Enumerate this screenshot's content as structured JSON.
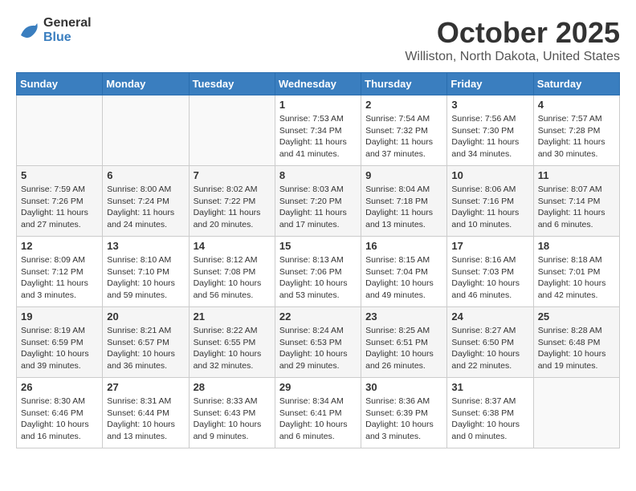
{
  "logo": {
    "line1": "General",
    "line2": "Blue"
  },
  "title": "October 2025",
  "location": "Williston, North Dakota, United States",
  "weekdays": [
    "Sunday",
    "Monday",
    "Tuesday",
    "Wednesday",
    "Thursday",
    "Friday",
    "Saturday"
  ],
  "weeks": [
    [
      {
        "day": "",
        "sunrise": "",
        "sunset": "",
        "daylight": ""
      },
      {
        "day": "",
        "sunrise": "",
        "sunset": "",
        "daylight": ""
      },
      {
        "day": "",
        "sunrise": "",
        "sunset": "",
        "daylight": ""
      },
      {
        "day": "1",
        "sunrise": "Sunrise: 7:53 AM",
        "sunset": "Sunset: 7:34 PM",
        "daylight": "Daylight: 11 hours and 41 minutes."
      },
      {
        "day": "2",
        "sunrise": "Sunrise: 7:54 AM",
        "sunset": "Sunset: 7:32 PM",
        "daylight": "Daylight: 11 hours and 37 minutes."
      },
      {
        "day": "3",
        "sunrise": "Sunrise: 7:56 AM",
        "sunset": "Sunset: 7:30 PM",
        "daylight": "Daylight: 11 hours and 34 minutes."
      },
      {
        "day": "4",
        "sunrise": "Sunrise: 7:57 AM",
        "sunset": "Sunset: 7:28 PM",
        "daylight": "Daylight: 11 hours and 30 minutes."
      }
    ],
    [
      {
        "day": "5",
        "sunrise": "Sunrise: 7:59 AM",
        "sunset": "Sunset: 7:26 PM",
        "daylight": "Daylight: 11 hours and 27 minutes."
      },
      {
        "day": "6",
        "sunrise": "Sunrise: 8:00 AM",
        "sunset": "Sunset: 7:24 PM",
        "daylight": "Daylight: 11 hours and 24 minutes."
      },
      {
        "day": "7",
        "sunrise": "Sunrise: 8:02 AM",
        "sunset": "Sunset: 7:22 PM",
        "daylight": "Daylight: 11 hours and 20 minutes."
      },
      {
        "day": "8",
        "sunrise": "Sunrise: 8:03 AM",
        "sunset": "Sunset: 7:20 PM",
        "daylight": "Daylight: 11 hours and 17 minutes."
      },
      {
        "day": "9",
        "sunrise": "Sunrise: 8:04 AM",
        "sunset": "Sunset: 7:18 PM",
        "daylight": "Daylight: 11 hours and 13 minutes."
      },
      {
        "day": "10",
        "sunrise": "Sunrise: 8:06 AM",
        "sunset": "Sunset: 7:16 PM",
        "daylight": "Daylight: 11 hours and 10 minutes."
      },
      {
        "day": "11",
        "sunrise": "Sunrise: 8:07 AM",
        "sunset": "Sunset: 7:14 PM",
        "daylight": "Daylight: 11 hours and 6 minutes."
      }
    ],
    [
      {
        "day": "12",
        "sunrise": "Sunrise: 8:09 AM",
        "sunset": "Sunset: 7:12 PM",
        "daylight": "Daylight: 11 hours and 3 minutes."
      },
      {
        "day": "13",
        "sunrise": "Sunrise: 8:10 AM",
        "sunset": "Sunset: 7:10 PM",
        "daylight": "Daylight: 10 hours and 59 minutes."
      },
      {
        "day": "14",
        "sunrise": "Sunrise: 8:12 AM",
        "sunset": "Sunset: 7:08 PM",
        "daylight": "Daylight: 10 hours and 56 minutes."
      },
      {
        "day": "15",
        "sunrise": "Sunrise: 8:13 AM",
        "sunset": "Sunset: 7:06 PM",
        "daylight": "Daylight: 10 hours and 53 minutes."
      },
      {
        "day": "16",
        "sunrise": "Sunrise: 8:15 AM",
        "sunset": "Sunset: 7:04 PM",
        "daylight": "Daylight: 10 hours and 49 minutes."
      },
      {
        "day": "17",
        "sunrise": "Sunrise: 8:16 AM",
        "sunset": "Sunset: 7:03 PM",
        "daylight": "Daylight: 10 hours and 46 minutes."
      },
      {
        "day": "18",
        "sunrise": "Sunrise: 8:18 AM",
        "sunset": "Sunset: 7:01 PM",
        "daylight": "Daylight: 10 hours and 42 minutes."
      }
    ],
    [
      {
        "day": "19",
        "sunrise": "Sunrise: 8:19 AM",
        "sunset": "Sunset: 6:59 PM",
        "daylight": "Daylight: 10 hours and 39 minutes."
      },
      {
        "day": "20",
        "sunrise": "Sunrise: 8:21 AM",
        "sunset": "Sunset: 6:57 PM",
        "daylight": "Daylight: 10 hours and 36 minutes."
      },
      {
        "day": "21",
        "sunrise": "Sunrise: 8:22 AM",
        "sunset": "Sunset: 6:55 PM",
        "daylight": "Daylight: 10 hours and 32 minutes."
      },
      {
        "day": "22",
        "sunrise": "Sunrise: 8:24 AM",
        "sunset": "Sunset: 6:53 PM",
        "daylight": "Daylight: 10 hours and 29 minutes."
      },
      {
        "day": "23",
        "sunrise": "Sunrise: 8:25 AM",
        "sunset": "Sunset: 6:51 PM",
        "daylight": "Daylight: 10 hours and 26 minutes."
      },
      {
        "day": "24",
        "sunrise": "Sunrise: 8:27 AM",
        "sunset": "Sunset: 6:50 PM",
        "daylight": "Daylight: 10 hours and 22 minutes."
      },
      {
        "day": "25",
        "sunrise": "Sunrise: 8:28 AM",
        "sunset": "Sunset: 6:48 PM",
        "daylight": "Daylight: 10 hours and 19 minutes."
      }
    ],
    [
      {
        "day": "26",
        "sunrise": "Sunrise: 8:30 AM",
        "sunset": "Sunset: 6:46 PM",
        "daylight": "Daylight: 10 hours and 16 minutes."
      },
      {
        "day": "27",
        "sunrise": "Sunrise: 8:31 AM",
        "sunset": "Sunset: 6:44 PM",
        "daylight": "Daylight: 10 hours and 13 minutes."
      },
      {
        "day": "28",
        "sunrise": "Sunrise: 8:33 AM",
        "sunset": "Sunset: 6:43 PM",
        "daylight": "Daylight: 10 hours and 9 minutes."
      },
      {
        "day": "29",
        "sunrise": "Sunrise: 8:34 AM",
        "sunset": "Sunset: 6:41 PM",
        "daylight": "Daylight: 10 hours and 6 minutes."
      },
      {
        "day": "30",
        "sunrise": "Sunrise: 8:36 AM",
        "sunset": "Sunset: 6:39 PM",
        "daylight": "Daylight: 10 hours and 3 minutes."
      },
      {
        "day": "31",
        "sunrise": "Sunrise: 8:37 AM",
        "sunset": "Sunset: 6:38 PM",
        "daylight": "Daylight: 10 hours and 0 minutes."
      },
      {
        "day": "",
        "sunrise": "",
        "sunset": "",
        "daylight": ""
      }
    ]
  ]
}
